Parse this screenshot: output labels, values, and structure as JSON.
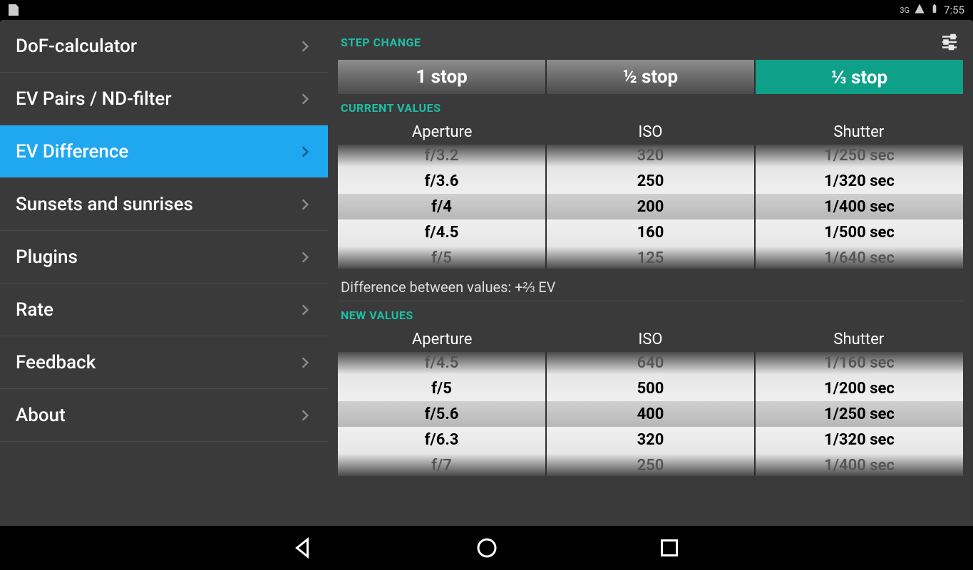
{
  "status": {
    "clock": "7:55",
    "signal": "3G"
  },
  "sidebar": {
    "items": [
      {
        "label": "DoF-calculator",
        "selected": false
      },
      {
        "label": "EV Pairs / ND-filter",
        "selected": false
      },
      {
        "label": "EV Difference",
        "selected": true
      },
      {
        "label": "Sunsets and sunrises",
        "selected": false
      },
      {
        "label": "Plugins",
        "selected": false
      },
      {
        "label": "Rate",
        "selected": false
      },
      {
        "label": "Feedback",
        "selected": false
      },
      {
        "label": "About",
        "selected": false
      }
    ]
  },
  "step_change": {
    "label": "STEP CHANGE",
    "options": [
      "1 stop",
      "½ stop",
      "⅓ stop"
    ],
    "selected_index": 2
  },
  "current": {
    "label": "CURRENT VALUES",
    "headers": [
      "Aperture",
      "ISO",
      "Shutter"
    ],
    "aperture": [
      "f/3.2",
      "f/3.6",
      "f/4",
      "f/4.5",
      "f/5"
    ],
    "iso": [
      "320",
      "250",
      "200",
      "160",
      "125"
    ],
    "shutter": [
      "1/250 sec",
      "1/320 sec",
      "1/400 sec",
      "1/500 sec",
      "1/640 sec"
    ],
    "selected_row": 2
  },
  "difference": {
    "text": "Difference between values: +⅔ EV"
  },
  "new": {
    "label": "NEW VALUES",
    "headers": [
      "Aperture",
      "ISO",
      "Shutter"
    ],
    "aperture": [
      "f/4.5",
      "f/5",
      "f/5.6",
      "f/6.3",
      "f/7"
    ],
    "iso": [
      "640",
      "500",
      "400",
      "320",
      "250"
    ],
    "shutter": [
      "1/160 sec",
      "1/200 sec",
      "1/250 sec",
      "1/320 sec",
      "1/400 sec"
    ],
    "selected_row": 2
  }
}
